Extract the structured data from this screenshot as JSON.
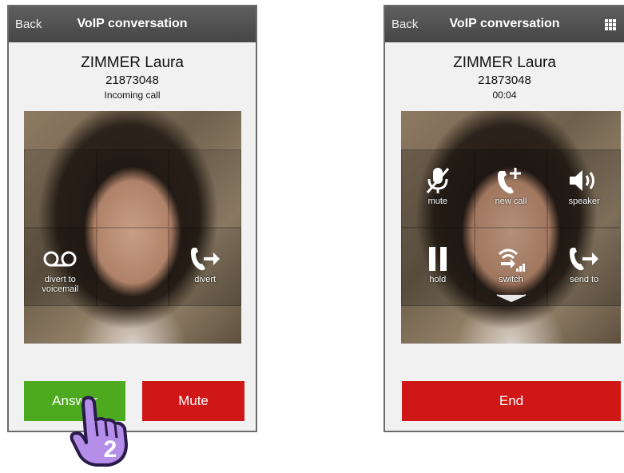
{
  "left": {
    "header": {
      "back_label": "Back",
      "title": "VoIP conversation"
    },
    "caller": {
      "name": "ZIMMER Laura",
      "number": "21873048",
      "status": "Incoming call"
    },
    "actions": {
      "divert_voicemail_line1": "divert to",
      "divert_voicemail_line2": "voicemail",
      "divert_label": "divert"
    },
    "buttons": {
      "answer_label": "Answer",
      "mute_label": "Mute"
    },
    "step_badge": "2"
  },
  "right": {
    "header": {
      "back_label": "Back",
      "title": "VoIP conversation",
      "menu_icon": "grid-icon"
    },
    "caller": {
      "name": "ZIMMER Laura",
      "number": "21873048",
      "duration": "00:04"
    },
    "actions": {
      "mute_label": "mute",
      "new_call_label": "new call",
      "speaker_label": "speaker",
      "hold_label": "hold",
      "switch_label": "switch",
      "send_to_label": "send to"
    },
    "buttons": {
      "end_label": "End"
    }
  },
  "colors": {
    "answer": "#4da91e",
    "reject": "#d01717",
    "header": "#4f4f4f",
    "badge": "#b48ee8"
  }
}
